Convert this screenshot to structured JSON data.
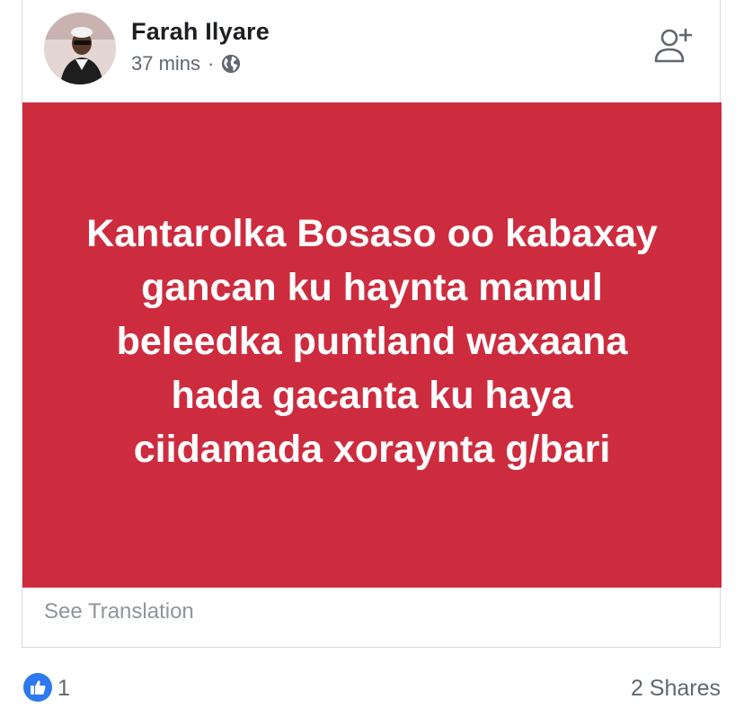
{
  "post": {
    "author": "Farah Ilyare",
    "time": "37 mins",
    "separator": "·",
    "privacy_icon": "globe-icon",
    "header_action_icon": "add-friend-icon",
    "banner_text": "Kantarolka Bosaso oo kabaxay gancan ku haynta mamul beleedka puntland waxaana hada gacanta ku haya ciidamada xoraynta g/bari",
    "banner_color": "#cd2c3f",
    "see_translation": "See Translation"
  },
  "footer": {
    "reaction_icon": "thumbs-up-icon",
    "reaction_count": "1",
    "shares": "2 Shares"
  }
}
